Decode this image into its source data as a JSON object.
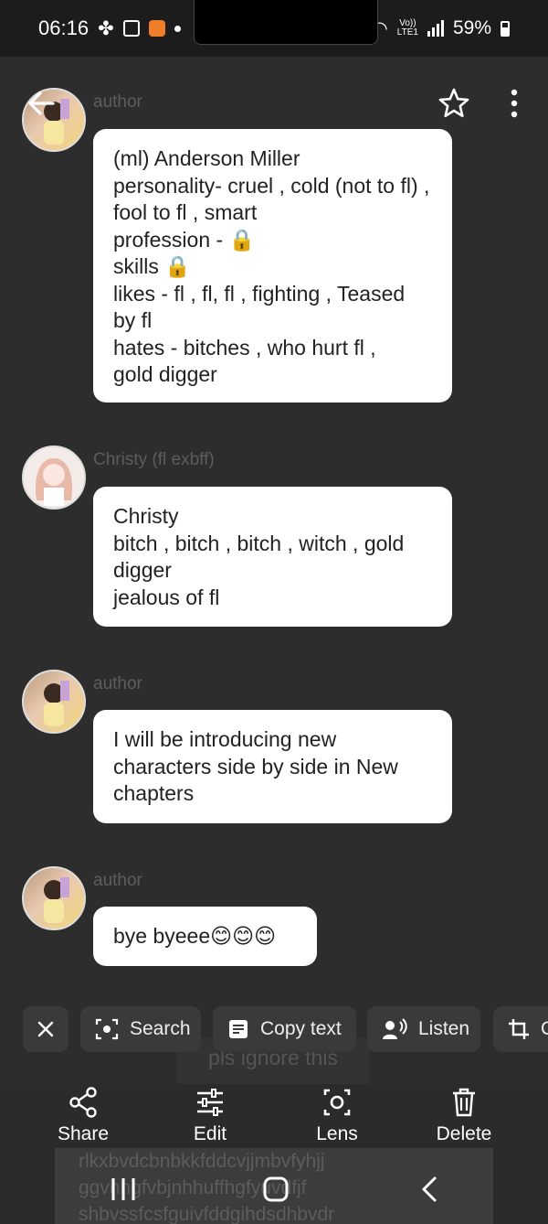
{
  "status": {
    "time": "06:16",
    "network": "Vo))",
    "network_sub": "LTE1",
    "battery": "59%"
  },
  "messages": [
    {
      "sender": "author",
      "text": "(ml) Anderson Miller\npersonality- cruel , cold (not to fl) , fool to fl , smart\nprofession - 🔒\nskills 🔒\nlikes - fl , fl,  fl , fighting , Teased by fl\nhates - bitches , who hurt fl ,\ngold digger"
    },
    {
      "sender": "Christy (fl exbff)",
      "text": "Christy\nbitch , bitch , bitch , witch , gold digger\njealous of fl"
    },
    {
      "sender": "author",
      "text": "I will be introducing new characters  side by side in New chapters"
    },
    {
      "sender": "author",
      "text": "bye byeee😊😊😊"
    }
  ],
  "chips": {
    "search": "Search",
    "copy_text": "Copy text",
    "listen": "Listen",
    "crop_partial": "C"
  },
  "ghost_text": "pls ignore this",
  "actions": {
    "share": "Share",
    "edit": "Edit",
    "lens": "Lens",
    "delete": "Delete"
  },
  "background_text": "rlkxbvdcbnbkkfddcvjjmbvfyhjj\nggvhngfvbjnhhuffhgfyuvdfjf\nshbvssfcsfguivfddgihdsdhbvdr"
}
